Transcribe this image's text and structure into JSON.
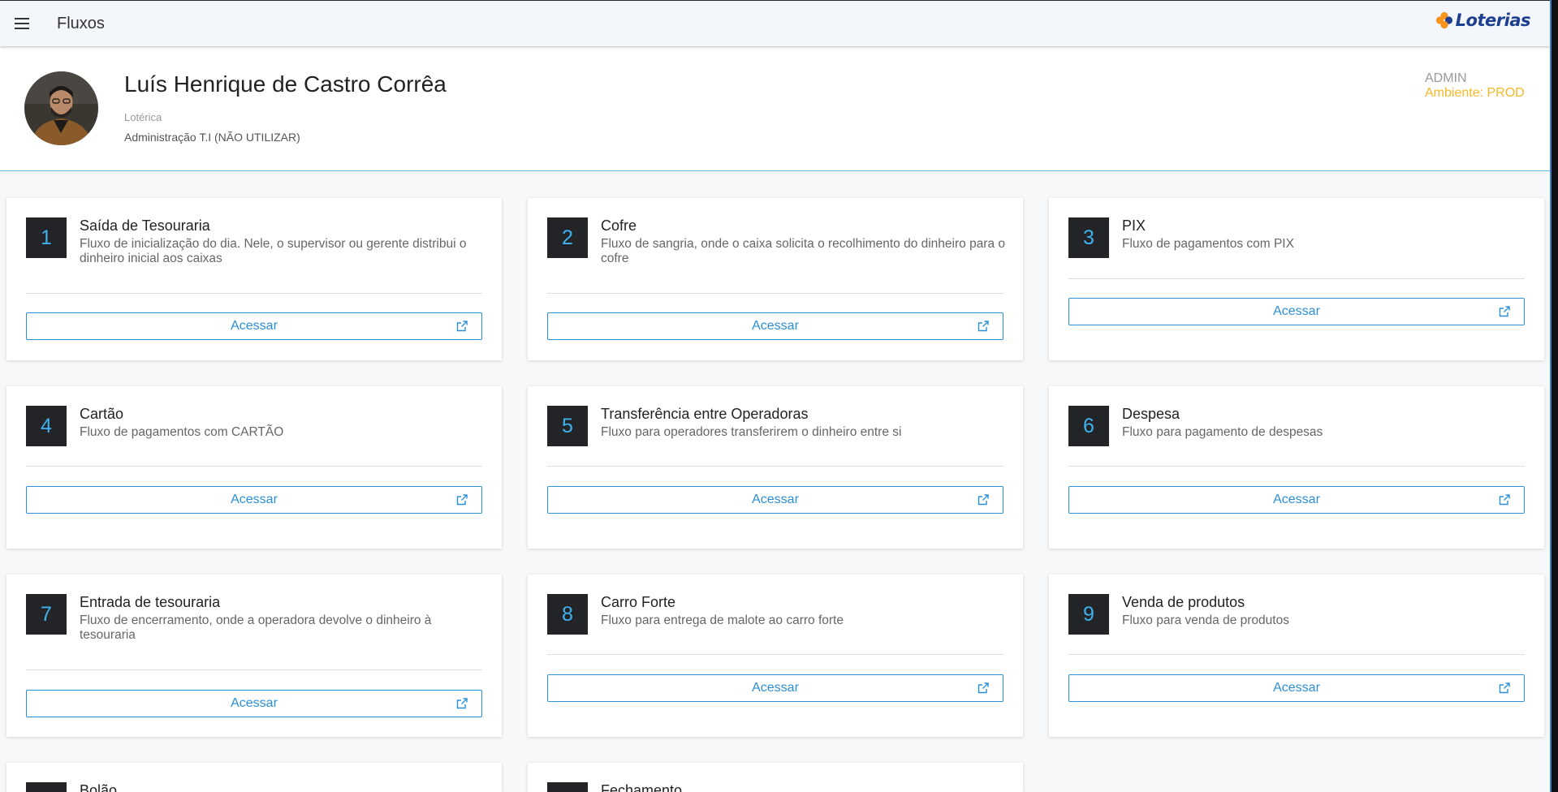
{
  "header": {
    "menu_icon": "menu-icon",
    "title": "Fluxos",
    "logo_text": "Loterias",
    "logo_icon": "clover-icon",
    "bg_color": "#f3f6fb"
  },
  "profile": {
    "name": "Luís Henrique de Castro Corrêa",
    "role": "Lotérica",
    "organization": "Administração T.I (NÃO UTILIZAR)",
    "admin_label": "ADMIN",
    "environment": "Ambiente: PROD",
    "environment_color": "#f6b826"
  },
  "cards": [
    {
      "number": "1",
      "title": "Saída de Tesouraria",
      "description": "Fluxo de inicialização do dia. Nele, o supervisor ou gerente distribui o dinheiro inicial aos caixas",
      "button": "Acessar"
    },
    {
      "number": "2",
      "title": "Cofre",
      "description": "Fluxo de sangria, onde o caixa solicita o recolhimento do dinheiro para o cofre",
      "button": "Acessar"
    },
    {
      "number": "3",
      "title": "PIX",
      "description": "Fluxo de pagamentos com PIX",
      "button": "Acessar"
    },
    {
      "number": "4",
      "title": "Cartão",
      "description": "Fluxo de pagamentos com CARTÃO",
      "button": "Acessar"
    },
    {
      "number": "5",
      "title": "Transferência entre Operadoras",
      "description": "Fluxo para operadores transferirem o dinheiro entre si",
      "button": "Acessar"
    },
    {
      "number": "6",
      "title": "Despesa",
      "description": "Fluxo para pagamento de despesas",
      "button": "Acessar"
    },
    {
      "number": "7",
      "title": "Entrada de tesouraria",
      "description": "Fluxo de encerramento, onde a operadora devolve o dinheiro à tesouraria",
      "button": "Acessar"
    },
    {
      "number": "8",
      "title": "Carro Forte",
      "description": "Fluxo para entrega de malote ao carro forte",
      "button": "Acessar"
    },
    {
      "number": "9",
      "title": "Venda de produtos",
      "description": "Fluxo para venda de produtos",
      "button": "Acessar"
    },
    {
      "number": "",
      "title": "Bolão",
      "description": "",
      "button": ""
    },
    {
      "number": "",
      "title": "Fechamento",
      "description": "",
      "button": ""
    }
  ],
  "colors": {
    "accent": "#2b8fd6",
    "number_text": "#3fb2ef",
    "number_bg": "#222428"
  }
}
